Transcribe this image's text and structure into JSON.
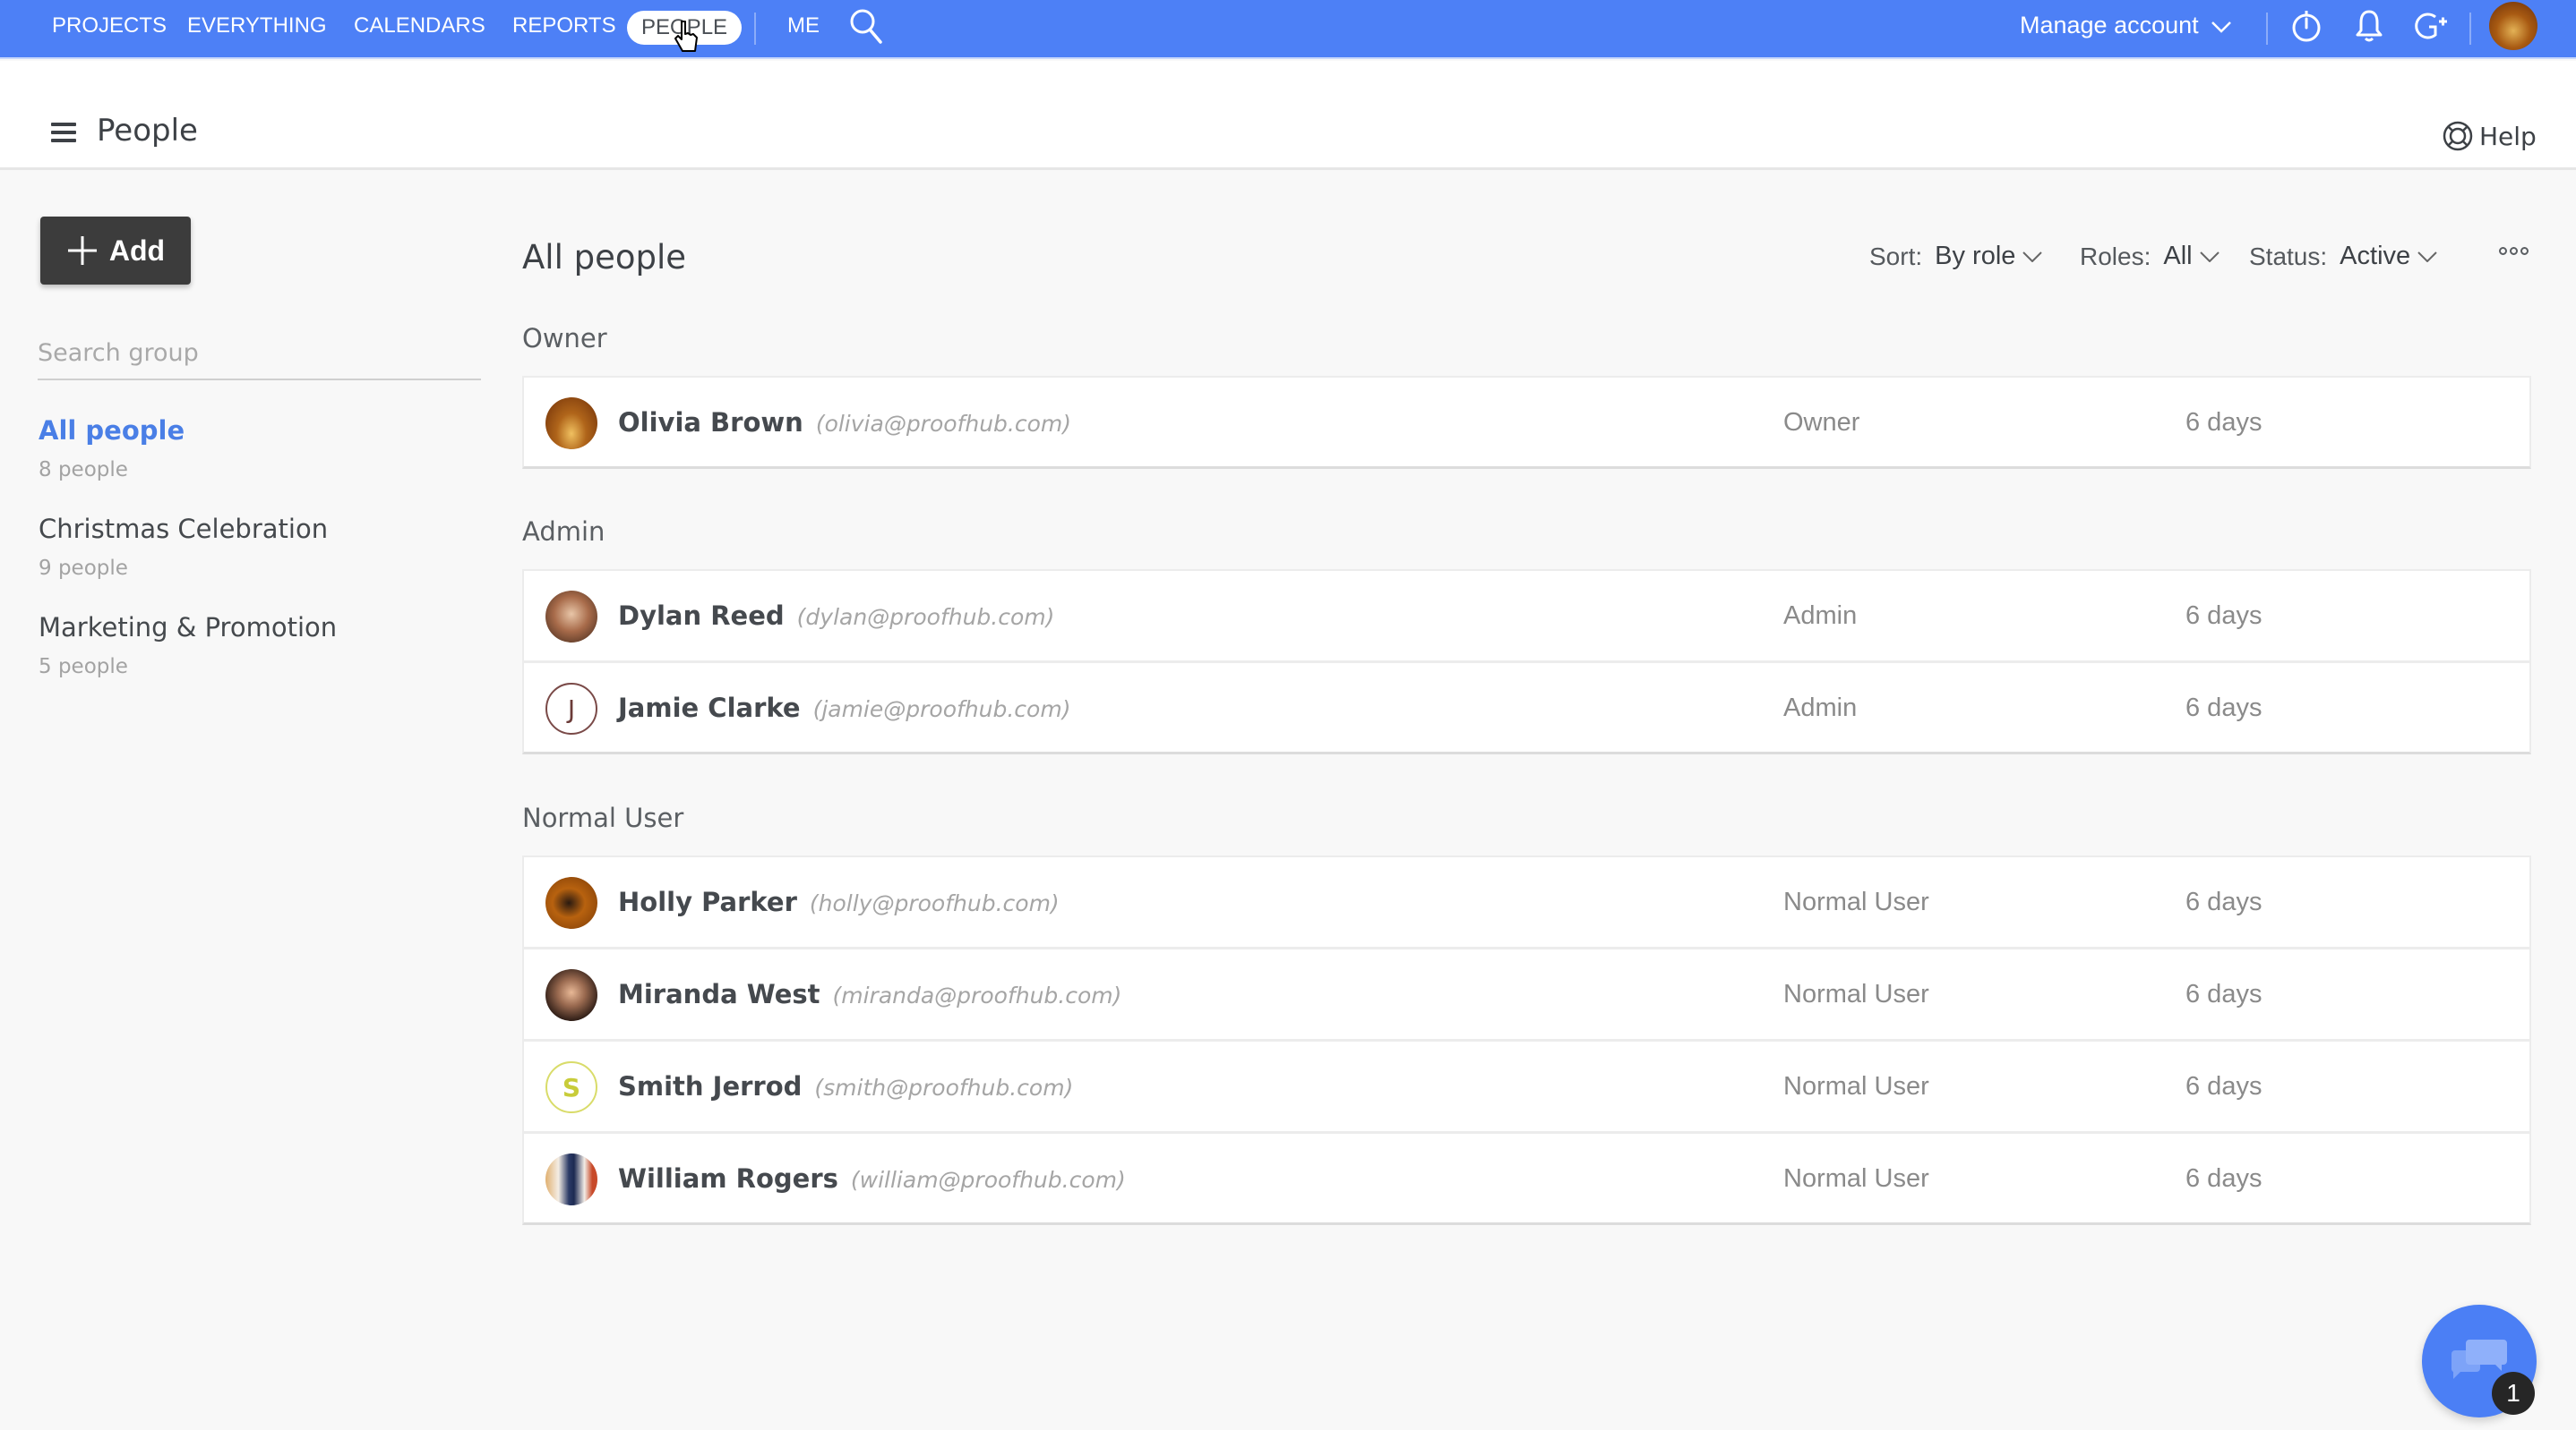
{
  "topnav": {
    "items": [
      "PROJECTS",
      "EVERYTHING",
      "CALENDARS",
      "REPORTS",
      "PEOPLE",
      "ME"
    ],
    "active": "PEOPLE",
    "search_icon": "search-icon",
    "manage_account": "Manage account",
    "icons": [
      "timer-icon",
      "bell-icon",
      "add-user-icon",
      "user-avatar"
    ],
    "accent_color": "#4d80f6"
  },
  "header": {
    "menu_icon": "hamburger-menu-icon",
    "title": "People",
    "help_label": "Help",
    "help_icon": "lifebuoy-icon"
  },
  "sidebar": {
    "add_label": "Add",
    "search_placeholder": "Search group",
    "groups": [
      {
        "name": "All people",
        "count": "8 people",
        "active": true
      },
      {
        "name": "Christmas Celebration",
        "count": "9 people",
        "active": false
      },
      {
        "name": "Marketing & Promotion",
        "count": "5 people",
        "active": false
      }
    ]
  },
  "main": {
    "title": "All people",
    "filters": {
      "sort_label": "Sort:",
      "sort_value": "By role",
      "roles_label": "Roles:",
      "roles_value": "All",
      "status_label": "Status:",
      "status_value": "Active"
    },
    "sections": [
      {
        "heading": "Owner",
        "people": [
          {
            "name": "Olivia Brown",
            "email": "(olivia@proofhub.com)",
            "role": "Owner",
            "time": "6 days",
            "avatar": "photo"
          }
        ]
      },
      {
        "heading": "Admin",
        "people": [
          {
            "name": "Dylan Reed",
            "email": "(dylan@proofhub.com)",
            "role": "Admin",
            "time": "6 days",
            "avatar": "photo"
          },
          {
            "name": "Jamie Clarke",
            "email": "(jamie@proofhub.com)",
            "role": "Admin",
            "time": "6 days",
            "avatar": "J"
          }
        ]
      },
      {
        "heading": "Normal User",
        "people": [
          {
            "name": "Holly Parker",
            "email": "(holly@proofhub.com)",
            "role": "Normal User",
            "time": "6 days",
            "avatar": "photo"
          },
          {
            "name": "Miranda West",
            "email": "(miranda@proofhub.com)",
            "role": "Normal User",
            "time": "6 days",
            "avatar": "photo"
          },
          {
            "name": "Smith Jerrod",
            "email": "(smith@proofhub.com)",
            "role": "Normal User",
            "time": "6 days",
            "avatar": "S"
          },
          {
            "name": "William Rogers",
            "email": "(william@proofhub.com)",
            "role": "Normal User",
            "time": "6 days",
            "avatar": "photo"
          }
        ]
      }
    ]
  },
  "chat": {
    "badge_count": "1"
  }
}
